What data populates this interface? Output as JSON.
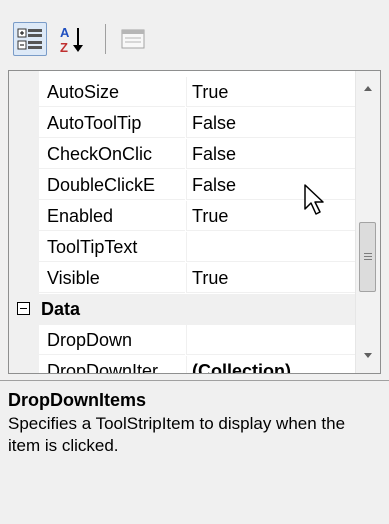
{
  "toolbar": {
    "categorized_icon": "categorized-view-icon",
    "alphabetical_icon": "alphabetical-sort-icon",
    "property_pages_icon": "property-pages-icon"
  },
  "properties": [
    {
      "name": "AutoSize",
      "value": "True"
    },
    {
      "name": "AutoToolTip",
      "value": "False"
    },
    {
      "name": "CheckOnClic",
      "value": "False"
    },
    {
      "name": "DoubleClickE",
      "value": "False"
    },
    {
      "name": "Enabled",
      "value": "True"
    },
    {
      "name": "ToolTipText",
      "value": ""
    },
    {
      "name": "Visible",
      "value": "True"
    }
  ],
  "category": {
    "name": "Data"
  },
  "data_properties": [
    {
      "name": "DropDown",
      "value": ""
    },
    {
      "name": "DropDownIter",
      "value": "(Collection)"
    }
  ],
  "description": {
    "title": "DropDownItems",
    "text": "Specifies a ToolStripItem to display when the item is clicked."
  }
}
